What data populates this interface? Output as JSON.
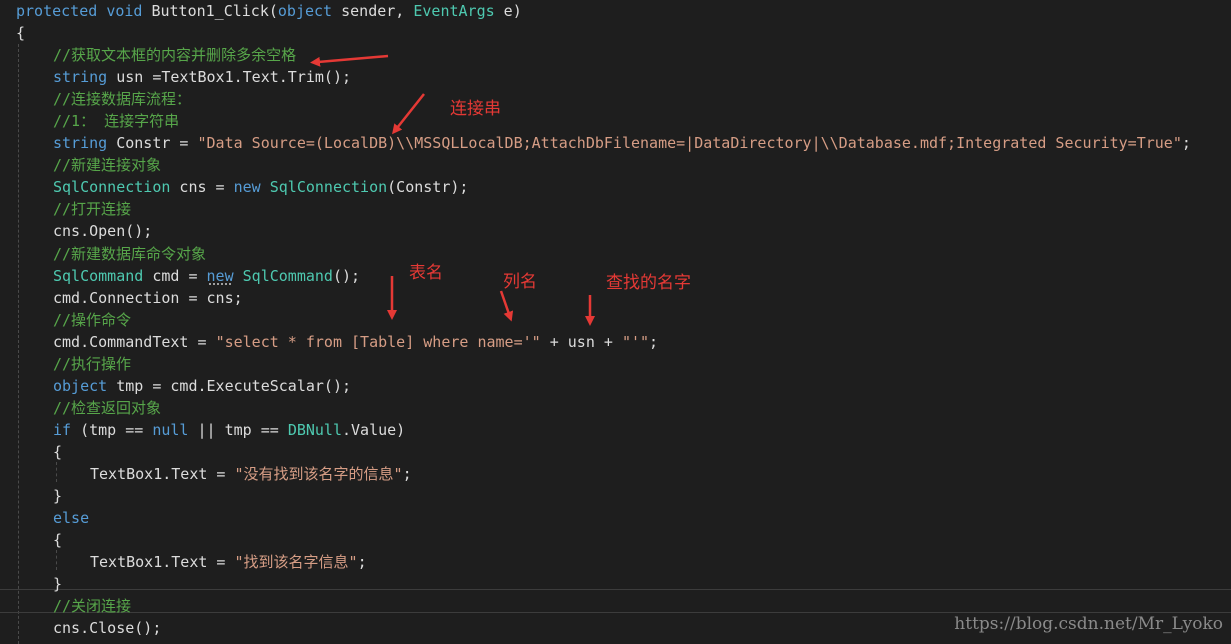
{
  "code": {
    "lines": [
      {
        "indent": 0,
        "tokens": [
          {
            "t": "kw",
            "v": "protected"
          },
          {
            "t": "pl",
            "v": " "
          },
          {
            "t": "kw",
            "v": "void"
          },
          {
            "t": "pl",
            "v": " Button1_Click("
          },
          {
            "t": "kw",
            "v": "object"
          },
          {
            "t": "pl",
            "v": " sender, "
          },
          {
            "t": "ty",
            "v": "EventArgs"
          },
          {
            "t": "pl",
            "v": " e)"
          }
        ]
      },
      {
        "indent": 0,
        "tokens": [
          {
            "t": "pl",
            "v": "{"
          }
        ]
      },
      {
        "indent": 1,
        "tokens": [
          {
            "t": "cm",
            "v": "//获取文本框的内容并删除多余空格"
          }
        ]
      },
      {
        "indent": 1,
        "tokens": [
          {
            "t": "kw",
            "v": "string"
          },
          {
            "t": "pl",
            "v": " usn =TextBox1.Text.Trim();"
          }
        ]
      },
      {
        "indent": 1,
        "tokens": [
          {
            "t": "cm",
            "v": "//连接数据库流程："
          }
        ]
      },
      {
        "indent": 1,
        "tokens": [
          {
            "t": "cm",
            "v": "//1： 连接字符串"
          }
        ]
      },
      {
        "indent": 1,
        "tokens": [
          {
            "t": "kw",
            "v": "string"
          },
          {
            "t": "pl",
            "v": " Constr = "
          },
          {
            "t": "st",
            "v": "\"Data Source=(LocalDB)\\\\MSSQLLocalDB;AttachDbFilename=|DataDirectory|\\\\Database.mdf;Integrated Security=True\""
          },
          {
            "t": "pl",
            "v": ";"
          }
        ]
      },
      {
        "indent": 1,
        "tokens": [
          {
            "t": "cm",
            "v": "//新建连接对象"
          }
        ]
      },
      {
        "indent": 1,
        "tokens": [
          {
            "t": "ty",
            "v": "SqlConnection"
          },
          {
            "t": "pl",
            "v": " cns = "
          },
          {
            "t": "kw",
            "v": "new"
          },
          {
            "t": "pl",
            "v": " "
          },
          {
            "t": "ty",
            "v": "SqlConnection"
          },
          {
            "t": "pl",
            "v": "(Constr);"
          }
        ]
      },
      {
        "indent": 1,
        "tokens": [
          {
            "t": "cm",
            "v": "//打开连接"
          }
        ]
      },
      {
        "indent": 1,
        "tokens": [
          {
            "t": "pl",
            "v": "cns.Open();"
          }
        ]
      },
      {
        "indent": 1,
        "tokens": [
          {
            "t": "cm",
            "v": "//新建数据库命令对象"
          }
        ]
      },
      {
        "indent": 1,
        "tokens": [
          {
            "t": "ty",
            "v": "SqlCommand"
          },
          {
            "t": "pl",
            "v": " cmd = "
          },
          {
            "t": "kw",
            "v": "new"
          },
          {
            "t": "pl",
            "v": " "
          },
          {
            "t": "ty",
            "v": "SqlCommand"
          },
          {
            "t": "pl",
            "v": "();"
          }
        ]
      },
      {
        "indent": 1,
        "tokens": [
          {
            "t": "pl",
            "v": "cmd.Connection = cns;"
          }
        ]
      },
      {
        "indent": 1,
        "tokens": [
          {
            "t": "cm",
            "v": "//操作命令"
          }
        ]
      },
      {
        "indent": 1,
        "tokens": [
          {
            "t": "pl",
            "v": "cmd.CommandText = "
          },
          {
            "t": "st",
            "v": "\"select * from [Table] where name='\""
          },
          {
            "t": "pl",
            "v": " + usn + "
          },
          {
            "t": "st",
            "v": "\"'\""
          },
          {
            "t": "pl",
            "v": ";"
          }
        ]
      },
      {
        "indent": 1,
        "tokens": [
          {
            "t": "cm",
            "v": "//执行操作"
          }
        ]
      },
      {
        "indent": 1,
        "tokens": [
          {
            "t": "kw",
            "v": "object"
          },
          {
            "t": "pl",
            "v": " tmp = cmd.ExecuteScalar();"
          }
        ]
      },
      {
        "indent": 1,
        "tokens": [
          {
            "t": "cm",
            "v": "//检查返回对象"
          }
        ]
      },
      {
        "indent": 1,
        "tokens": [
          {
            "t": "kw",
            "v": "if"
          },
          {
            "t": "pl",
            "v": " (tmp == "
          },
          {
            "t": "kw",
            "v": "null"
          },
          {
            "t": "pl",
            "v": " || tmp == "
          },
          {
            "t": "ty",
            "v": "DBNull"
          },
          {
            "t": "pl",
            "v": ".Value)"
          }
        ]
      },
      {
        "indent": 1,
        "tokens": [
          {
            "t": "pl",
            "v": "{"
          }
        ]
      },
      {
        "indent": 2,
        "tokens": [
          {
            "t": "pl",
            "v": "TextBox1.Text = "
          },
          {
            "t": "st",
            "v": "\"没有找到该名字的信息\""
          },
          {
            "t": "pl",
            "v": ";"
          }
        ]
      },
      {
        "indent": 1,
        "tokens": [
          {
            "t": "pl",
            "v": "}"
          }
        ]
      },
      {
        "indent": 1,
        "tokens": [
          {
            "t": "kw",
            "v": "else"
          }
        ]
      },
      {
        "indent": 1,
        "tokens": [
          {
            "t": "pl",
            "v": "{"
          }
        ]
      },
      {
        "indent": 2,
        "tokens": [
          {
            "t": "pl",
            "v": "TextBox1.Text = "
          },
          {
            "t": "st",
            "v": "\"找到该名字信息\""
          },
          {
            "t": "pl",
            "v": ";"
          }
        ]
      },
      {
        "indent": 1,
        "tokens": [
          {
            "t": "pl",
            "v": "}"
          }
        ]
      },
      {
        "indent": 1,
        "tokens": [
          {
            "t": "cm",
            "v": "//关闭连接"
          }
        ]
      },
      {
        "indent": 1,
        "tokens": [
          {
            "t": "pl",
            "v": "cns.Close();"
          }
        ]
      }
    ]
  },
  "annotations": {
    "connection_string": "连接串",
    "table_name": "表名",
    "column_name": "列名",
    "search_name": "查找的名字"
  },
  "watermark": "https://blog.csdn.net/Mr_Lyoko",
  "colors": {
    "background": "#1e1e1e",
    "keyword": "#569cd6",
    "type": "#4ec9b0",
    "comment": "#57a64a",
    "string": "#d69d85",
    "annotation": "#e53935"
  }
}
